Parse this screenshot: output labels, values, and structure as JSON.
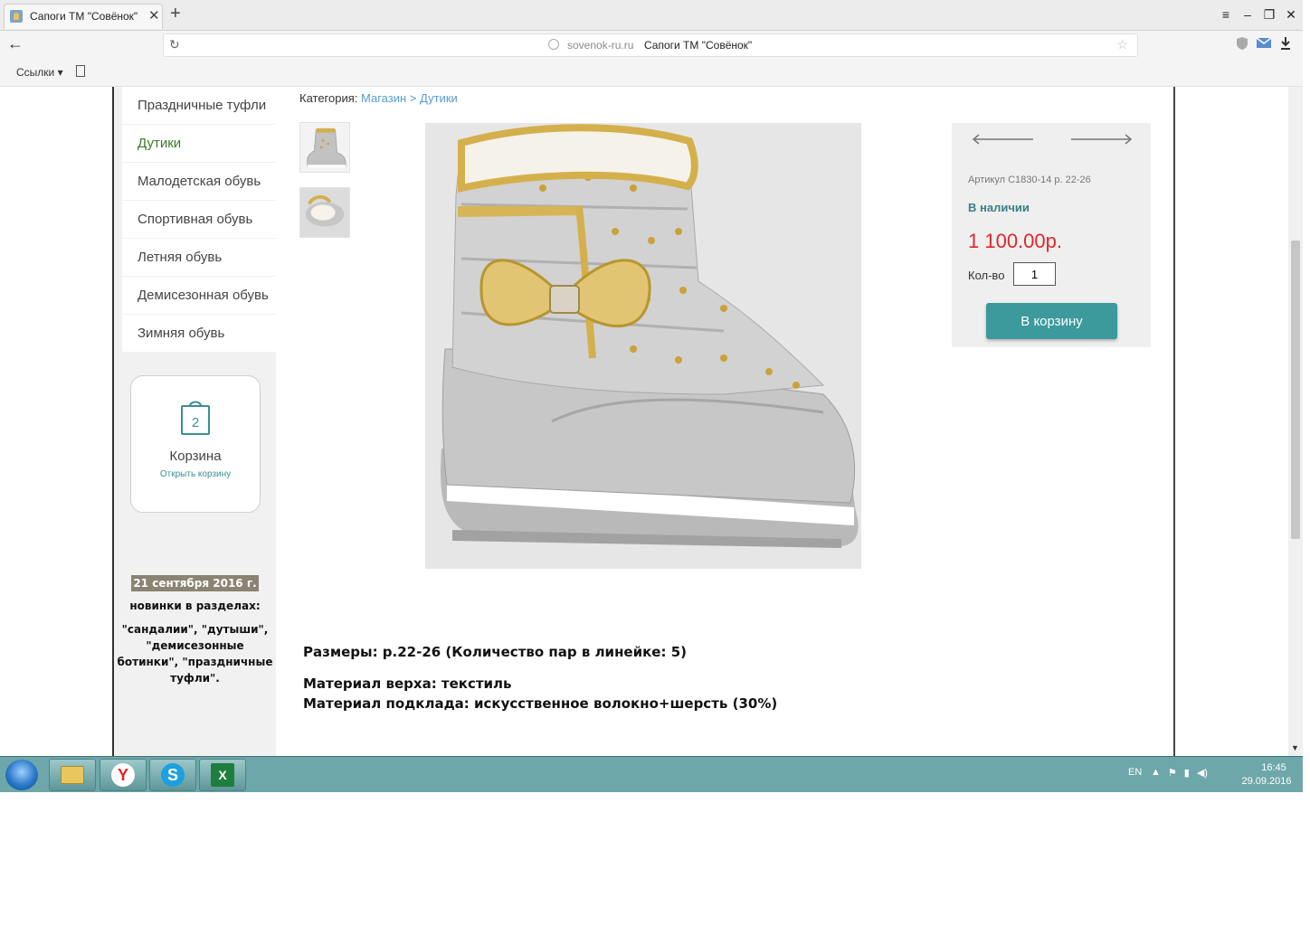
{
  "browser": {
    "tab_title": "Сапоги ТМ \"Совёнок\"",
    "tab_close": "✕",
    "new_tab": "+",
    "back": "←",
    "reload": "↻",
    "url_domain": "sovenok-ru.ru",
    "url_title": "Сапоги ТМ \"Совёнок\"",
    "star": "☆",
    "win_menu": "≡",
    "win_minimize": "–",
    "win_restore": "❐",
    "win_close": "✕",
    "bookmarks_label": "Ссылки ▾",
    "icons": [
      "shield-icon",
      "mail-icon",
      "download-icon",
      "star-icon",
      "reload-icon",
      "globe-icon",
      "page-icon"
    ]
  },
  "sidebar": {
    "menu": [
      {
        "label": "Праздничные туфли",
        "active": false
      },
      {
        "label": "Дутики",
        "active": true
      },
      {
        "label": "Малодетская обувь",
        "active": false
      },
      {
        "label": "Спортивная обувь",
        "active": false
      },
      {
        "label": "Летняя обувь",
        "active": false
      },
      {
        "label": "Демисезонная обувь",
        "active": false
      },
      {
        "label": "Зимняя обувь",
        "active": false
      }
    ],
    "cart": {
      "count": "2",
      "label": "Корзина",
      "link": "Открыть корзину"
    },
    "news": {
      "date": "21 сентября 2016 г.",
      "heading": "новинки в разделах:",
      "text": "\"сандалии\", \"дутыши\", \"демисезонные ботинки\", \"праздничные туфли\"."
    }
  },
  "product": {
    "breadcrumb_label": "Категория:",
    "breadcrumb": [
      "Магазин",
      "Дутики"
    ],
    "breadcrumb_sep": ">",
    "sku": "Артикул С1830-14 р. 22-26",
    "availability": "В наличии",
    "price": "1 100.00р.",
    "qty_label": "Кол-во",
    "qty_value": "1",
    "add_to_cart": "В корзину",
    "sizes": "Размеры: р.22-26 (Количество пар в линейке: 5)",
    "material_top": "Материал верха: текстиль",
    "material_lining": "Материал подклада: искусственное волокно+шерсть (30%)"
  },
  "taskbar": {
    "apps": [
      "folder-icon",
      "yandex-icon",
      "skype-icon",
      "excel-icon"
    ],
    "yandex_letter": "Y",
    "skype_letter": "S",
    "excel_letter": "X",
    "lang": "EN",
    "tray_up": "▲",
    "tray_flag": "⚑",
    "tray_battery": "▮",
    "tray_volume": "◀)",
    "time": "16:45",
    "date": "29.09.2016"
  },
  "colors": {
    "accent": "#3c999c",
    "price": "#e0262c",
    "link": "#5b9bd0",
    "active_menu": "#3b7a2a",
    "taskbar": "#6ea7aa"
  }
}
